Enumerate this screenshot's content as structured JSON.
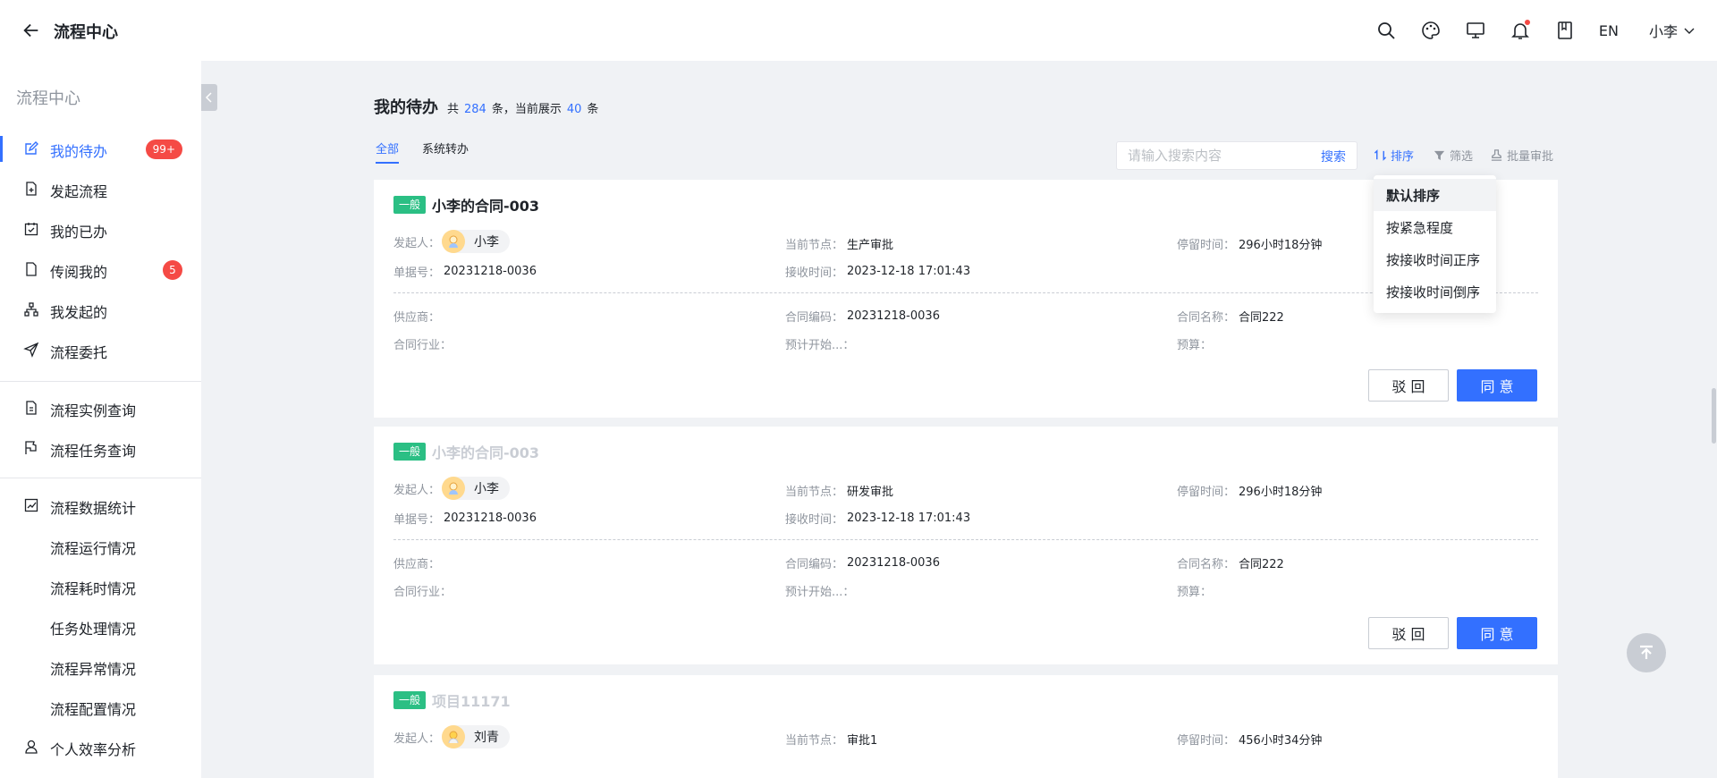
{
  "header": {
    "title": "流程中心",
    "lang": "EN",
    "user": "小李",
    "icons": [
      "search-icon",
      "palette-icon",
      "monitor-icon",
      "bell-icon",
      "book-icon"
    ]
  },
  "sidebar": {
    "title": "流程中心",
    "items": [
      {
        "label": "我的待办",
        "icon": "edit-icon",
        "badge": "99+",
        "active": true
      },
      {
        "label": "发起流程",
        "icon": "file-add-icon"
      },
      {
        "label": "我的已办",
        "icon": "calendar-check-icon"
      },
      {
        "label": "传阅我的",
        "icon": "file-icon",
        "badge": "5"
      },
      {
        "label": "我发起的",
        "icon": "org-icon"
      },
      {
        "label": "流程委托",
        "icon": "send-icon"
      },
      {
        "label": "流程实例查询",
        "icon": "file-search-icon"
      },
      {
        "label": "流程任务查询",
        "icon": "flag-icon"
      },
      {
        "label": "流程数据统计",
        "icon": "chart-icon"
      },
      {
        "label": "流程运行情况"
      },
      {
        "label": "流程耗时情况"
      },
      {
        "label": "任务处理情况"
      },
      {
        "label": "流程异常情况"
      },
      {
        "label": "流程配置情况"
      },
      {
        "label": "个人效率分析",
        "icon": "user-icon"
      }
    ]
  },
  "main": {
    "title": "我的待办",
    "stats_prefix": "共",
    "total": "284",
    "stats_mid": "条，当前展示",
    "shown": "40",
    "stats_suffix": "条",
    "tabs": [
      {
        "label": "全部",
        "active": true
      },
      {
        "label": "系统转办"
      }
    ],
    "search": {
      "placeholder": "请输入搜索内容",
      "button": "搜索"
    },
    "tools": {
      "sort": "排序",
      "filter": "筛选",
      "batch": "批量审批"
    },
    "sort_menu": [
      "默认排序",
      "按紧急程度",
      "按接收时间正序",
      "按接收时间倒序"
    ],
    "labels": {
      "initiator": "发起人：",
      "node": "当前节点：",
      "stay": "停留时间：",
      "doc_no": "单据号：",
      "received": "接收时间：",
      "supplier": "供应商：",
      "contract_code": "合同编码：",
      "contract_name": "合同名称：",
      "industry": "合同行业：",
      "planned": "预计开始...：",
      "budget": "预算："
    },
    "buttons": {
      "reject": "驳 回",
      "agree": "同 意"
    },
    "cards": [
      {
        "tag": "一般",
        "title": "小李的合同-003",
        "initiator": "小李",
        "node": "生产审批",
        "stay": "296小时18分钟",
        "doc_no": "20231218-0036",
        "received": "2023-12-18 17:01:43",
        "contract_code": "20231218-0036",
        "contract_name": "合同222"
      },
      {
        "tag": "一般",
        "title": "小李的合同-003",
        "initiator": "小李",
        "node": "研发审批",
        "stay": "296小时18分钟",
        "doc_no": "20231218-0036",
        "received": "2023-12-18 17:01:43",
        "contract_code": "20231218-0036",
        "contract_name": "合同222"
      },
      {
        "tag": "一般",
        "title": "项目11171",
        "initiator": "刘青",
        "node": "审批1",
        "stay": "456小时34分钟"
      }
    ]
  }
}
